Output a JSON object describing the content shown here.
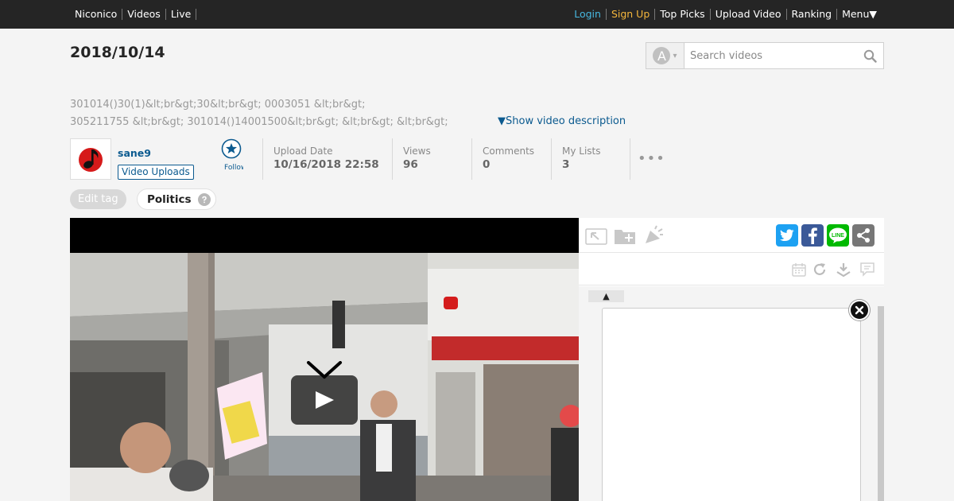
{
  "topbar": {
    "left_links": [
      "Niconico",
      "Videos",
      "Live"
    ],
    "login": "Login",
    "signup": "Sign Up",
    "right_links": [
      "Top Picks",
      "Upload Video",
      "Ranking",
      "Menu▼"
    ]
  },
  "video": {
    "title": "2018/10/14",
    "description_line1": "301014()30(1)&lt;br&gt;30&lt;br&gt; 0003051 &lt;br&gt;",
    "description_line2": "305211755 &lt;br&gt; 301014()14001500&lt;br&gt; &lt;br&gt; &lt;br&gt;",
    "show_description": "▼Show video description"
  },
  "search": {
    "placeholder": "Search videos",
    "mode_letter": "A",
    "mode_caret": "▾"
  },
  "owner": {
    "name": "sane9",
    "uploads_button": "Video Uploads",
    "follow_label": "Follow"
  },
  "stats": [
    {
      "label": "Upload Date",
      "value": "10/16/2018 22:58"
    },
    {
      "label": "Views",
      "value": "96"
    },
    {
      "label": "Comments",
      "value": "0"
    },
    {
      "label": "My Lists",
      "value": "3"
    }
  ],
  "more": "•••",
  "tags": {
    "edit_label": "Edit tag",
    "items": [
      "Politics"
    ]
  },
  "panel": {
    "tab_label": "▲"
  },
  "colors": {
    "accent": "#0b5a8f",
    "login": "#47b8e0",
    "signup": "#f6b73c",
    "twitter": "#1da1f2",
    "facebook": "#3b5998",
    "line": "#00b900",
    "share": "#777777"
  },
  "icons": {
    "search": "magnifier-icon",
    "follow": "star-icon",
    "close": "close-icon",
    "play": "play-icon"
  }
}
